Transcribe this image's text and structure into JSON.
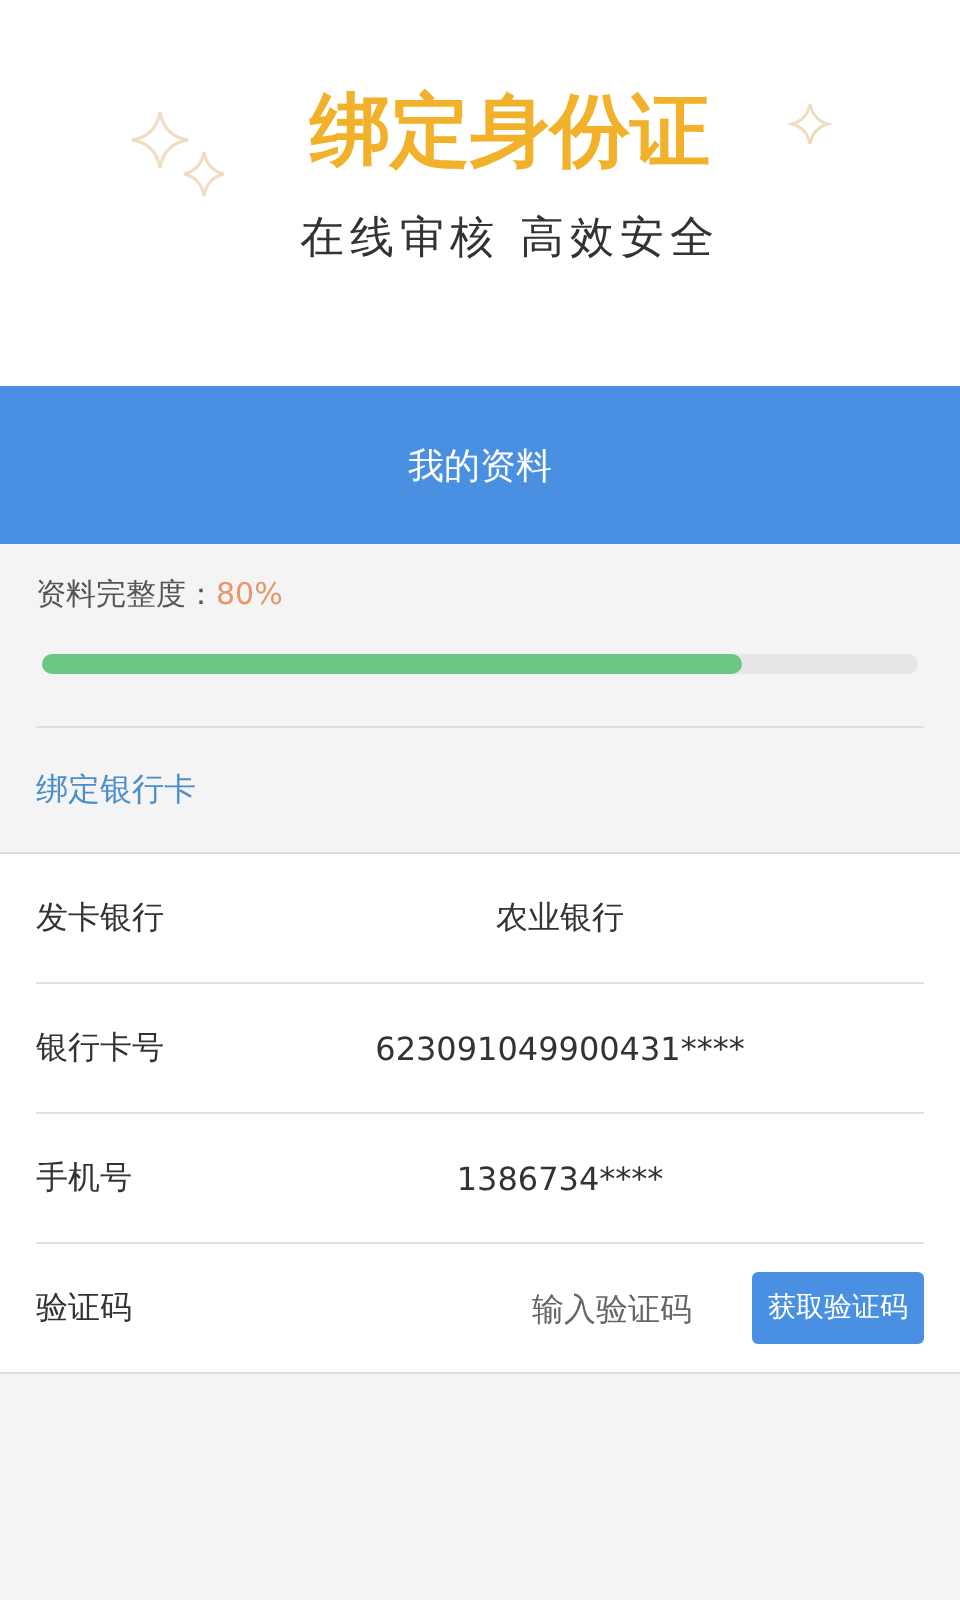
{
  "banner": {
    "title": "绑定身份证",
    "subtitle": "在线审核 高效安全"
  },
  "header": {
    "title": "我的资料"
  },
  "completeness": {
    "label": "资料完整度：",
    "value": "80%",
    "level": 0.8
  },
  "section_title": "绑定银行卡",
  "rows": [
    {
      "kind": "text",
      "label": "发卡银行",
      "value": "农业银行"
    },
    {
      "kind": "text",
      "label": "银行卡号",
      "value": "623091049900431****"
    },
    {
      "kind": "text",
      "label": "手机号",
      "value": "1386734****"
    },
    {
      "kind": "code",
      "label": "验证码",
      "placeholder": "输入验证码",
      "button": "获取验证码"
    }
  ]
}
